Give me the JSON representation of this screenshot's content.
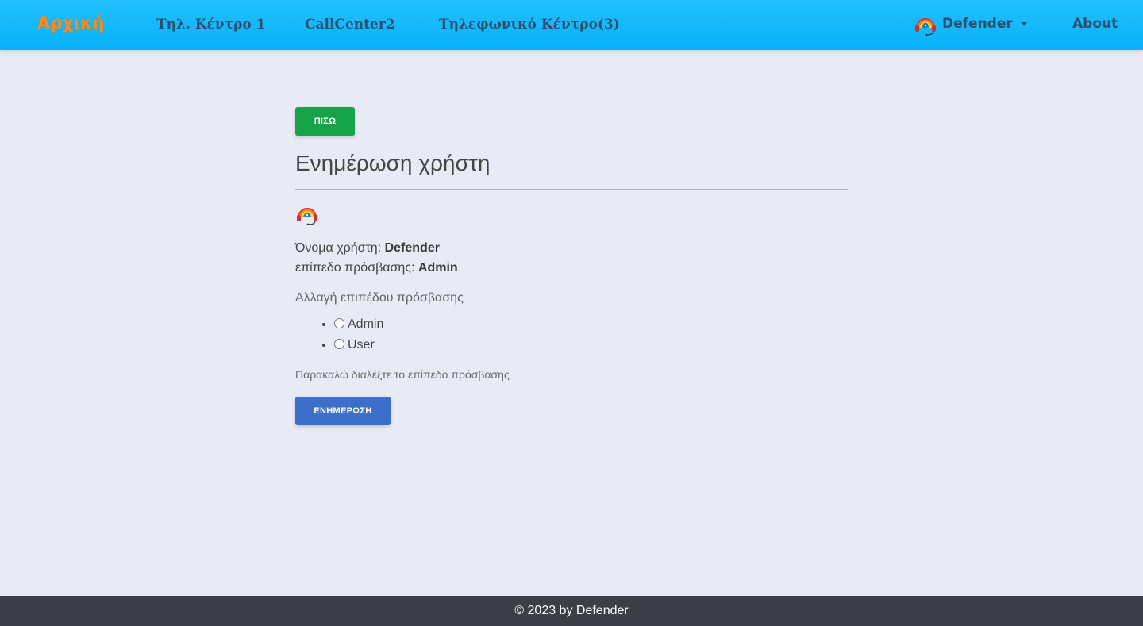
{
  "nav": {
    "brand": "Αρχική",
    "links": [
      "Τηλ. Κέντρο 1",
      "CallCenter2",
      "Τηλεφωνικό Κέντρο(3)"
    ],
    "user": {
      "name": "Defender",
      "icon": "headset-rainbow-avatar-icon"
    },
    "about": "About",
    "colors": {
      "bar": "#08b1fa",
      "brand": "#ff8a1c",
      "link": "#2d4f6e"
    }
  },
  "main": {
    "back_button": "ΠΙΣΩ",
    "title": "Ενημέρωση χρήστη",
    "avatar_icon": "headset-rainbow-avatar-icon",
    "username_label": "Όνομα χρήστη:",
    "username_value": "Defender",
    "access_label": "επίπεδο πρόσβασης:",
    "access_value": "Admin",
    "change_label": "Αλλαγή επιπέδου πρόσβασης",
    "options": [
      {
        "label": "Admin",
        "selected": false
      },
      {
        "label": "User",
        "selected": false
      }
    ],
    "hint": "Παρακαλώ διαλέξτε το επίπεδο πρόσβασης",
    "update_button": "ΕΝΗΜΕΡΩΣΗ",
    "colors": {
      "back": "#17a34a",
      "update": "#3b6fca"
    }
  },
  "footer": {
    "text": "© 2023 by Defender"
  }
}
